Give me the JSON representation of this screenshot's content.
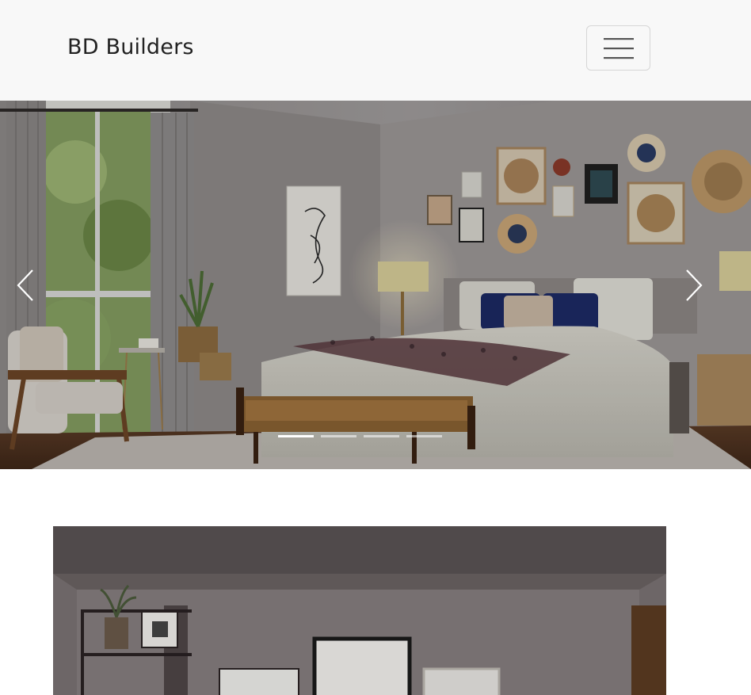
{
  "navbar": {
    "brand": "BD Builders",
    "toggle_icon": "hamburger-menu-icon"
  },
  "carousel": {
    "slide_count": 4,
    "active_index": 0,
    "prev_icon": "chevron-left-icon",
    "next_icon": "chevron-right-icon"
  },
  "second_image": {
    "icon": "room-photo"
  }
}
